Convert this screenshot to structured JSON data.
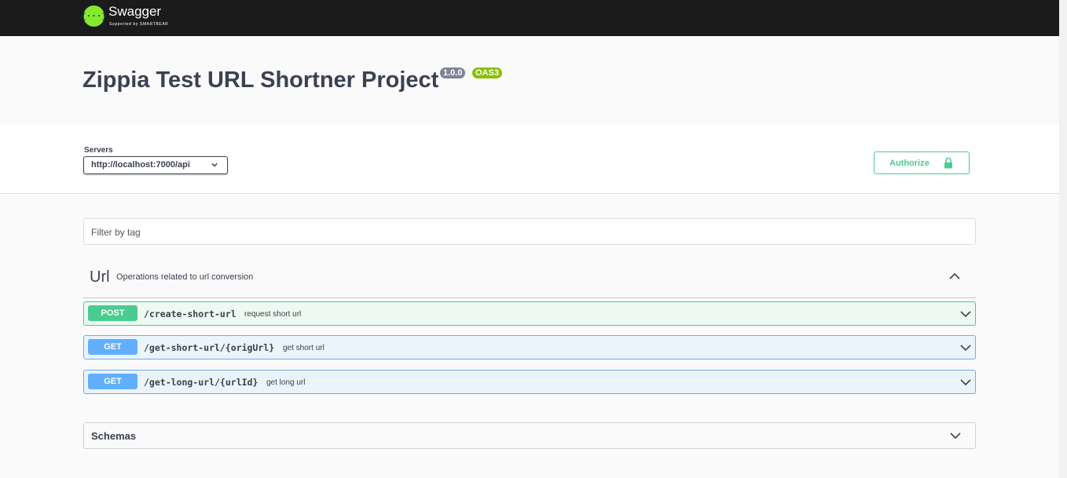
{
  "topbar": {
    "logo_glyph": "{···}",
    "logo_name": "Swagger",
    "logo_sub": "Supported by SMARTBEAR"
  },
  "info": {
    "title": "Zippia Test URL Shortner Project",
    "version": "1.0.0",
    "spec": "OAS3"
  },
  "servers": {
    "label": "Servers",
    "selected": "http://localhost:7000/api"
  },
  "authorize": {
    "label": "Authorize"
  },
  "filter": {
    "placeholder": "Filter by tag"
  },
  "tag": {
    "name": "Url",
    "description": "Operations related to url conversion"
  },
  "operations": [
    {
      "method": "POST",
      "path": "/create-short-url",
      "summary": "request short url"
    },
    {
      "method": "GET",
      "path": "/get-short-url/{origUrl}",
      "summary": "get short url"
    },
    {
      "method": "GET",
      "path": "/get-long-url/{urlId}",
      "summary": "get long url"
    }
  ],
  "schemas": {
    "title": "Schemas"
  },
  "colors": {
    "post": "#49cc90",
    "get": "#61affe",
    "swagger_green": "#85ea2d"
  }
}
